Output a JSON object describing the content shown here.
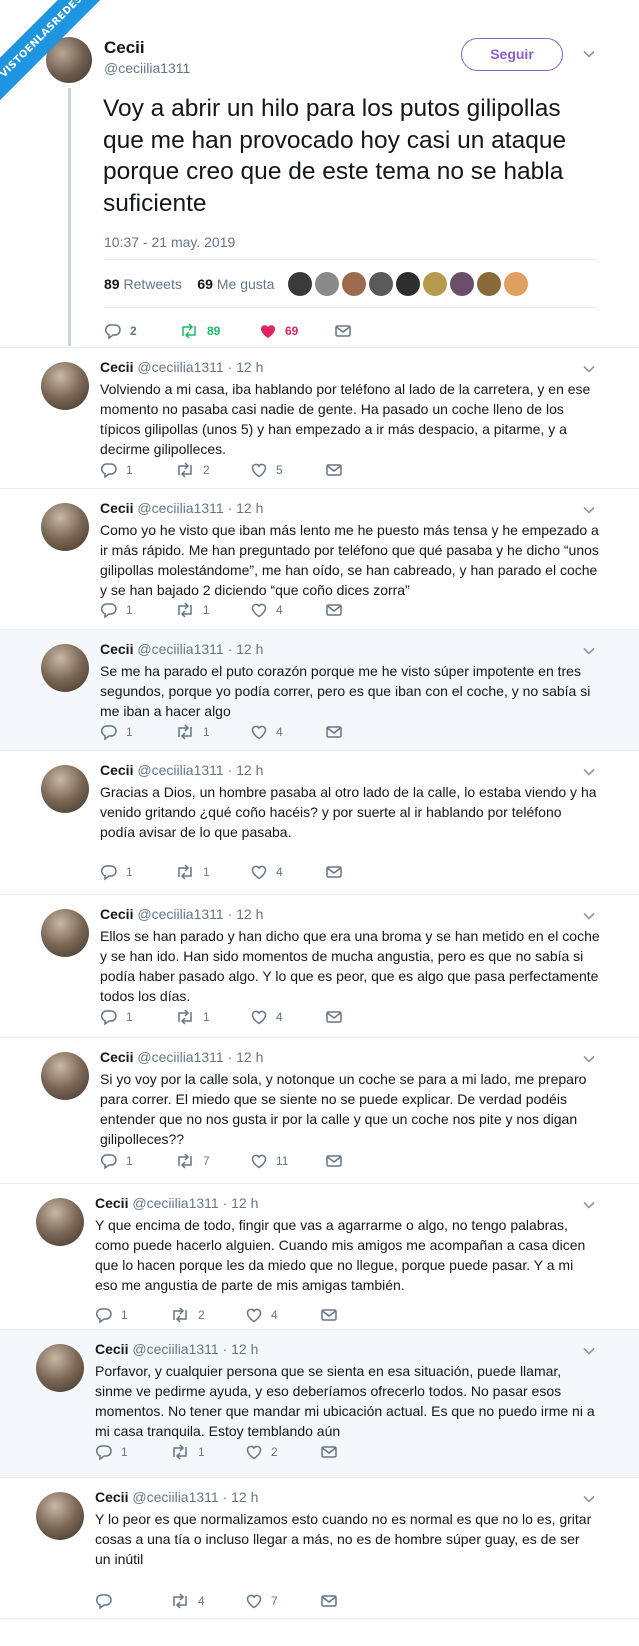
{
  "watermark": "VISTOENLASREDES",
  "colors": {
    "follow": "#8b5fd1",
    "retweet": "#17bf63",
    "like": "#e0245e",
    "muted": "#657786"
  },
  "main": {
    "name": "Cecii",
    "handle": "@ceciilia1311",
    "follow_label": "Seguir",
    "text": "Voy a abrir un hilo para los putos gilipollas que me han provocado hoy casi un ataque porque creo que de este tema no se habla suficiente",
    "time": "10:37 - 21 may. 2019",
    "retweets_count": "89",
    "retweets_label": "Retweets",
    "likes_count": "69",
    "likes_label": "Me gusta",
    "reply_count": "2",
    "retweet_count": "89",
    "like_count": "69"
  },
  "replies": [
    {
      "name": "Cecii",
      "handle": "@ceciilia1311 · 12 h",
      "text": "Volviendo a mi casa, iba hablando por teléfono al lado de la carretera, y en ese momento no pasaba casi nadie de gente. Ha pasado un coche lleno de los típicos gilipollas (unos 5) y han empezado a ir más despacio, a pitarme, y a decirme gilipolleces.",
      "replies": "1",
      "retweets": "2",
      "likes": "5"
    },
    {
      "name": "Cecii",
      "handle": "@ceciilia1311 · 12 h",
      "text": "Como yo he visto que iban más lento me he puesto más tensa y he empezado a ir más rápido. Me han preguntado por teléfono que qué pasaba y he dicho “unos gilipollas molestándome”, me han oído, se han cabreado, y han parado el coche y se han bajado 2 diciendo “que coño dices zorra”",
      "replies": "1",
      "retweets": "1",
      "likes": "4"
    },
    {
      "name": "Cecii",
      "handle": "@ceciilia1311 · 12 h",
      "text": "Se me ha parado el puto corazón porque me he visto súper impotente en tres segundos, porque yo podía correr, pero es que iban con el coche, y no sabía si me iban a hacer algo",
      "replies": "1",
      "retweets": "1",
      "likes": "4"
    },
    {
      "name": "Cecii",
      "handle": "@ceciilia1311 · 12 h",
      "text": "Gracias a Dios, un hombre pasaba al otro lado de la calle, lo estaba viendo y ha venido gritando ¿qué coño hacéis? y por suerte al ir hablando por teléfono podía avisar de lo que pasaba.",
      "replies": "1",
      "retweets": "1",
      "likes": "4"
    },
    {
      "name": "Cecii",
      "handle": "@ceciilia1311 · 12 h",
      "text": "Ellos se han parado y han dicho que era una broma y se han metido en el coche y se han ido. Han sido momentos de mucha angustia, pero es que no sabía si podía haber pasado algo. Y lo que es peor, que es algo que pasa perfectamente todos los días.",
      "replies": "1",
      "retweets": "1",
      "likes": "4"
    },
    {
      "name": "Cecii",
      "handle": "@ceciilia1311 · 12 h",
      "text": "Si yo voy por la calle sola, y notonque un coche se para a mi lado, me preparo para correr. El miedo que se siente no se puede explicar. De verdad podéis entender que no nos gusta ir por la calle y que un coche nos pite y nos digan gilipolleces??",
      "replies": "1",
      "retweets": "7",
      "likes": "11"
    },
    {
      "name": "Cecii",
      "handle": "@ceciilia1311 · 12 h",
      "text": "Y que encima de todo, fingir que vas a agarrarme o algo, no tengo palabras, como puede hacerlo alguien. Cuando mis amigos me acompañan a casa dicen que lo hacen porque les da miedo que no llegue, porque puede pasar. Y a mi eso me angustia de parte de mis amigas también.",
      "replies": "1",
      "retweets": "2",
      "likes": "4"
    },
    {
      "name": "Cecii",
      "handle": "@ceciilia1311 · 12 h",
      "text": "Porfavor, y cualquier persona que se sienta en esa situación, puede llamar, sinme ve pedirme ayuda, y eso deberíamos ofrecerlo todos. No pasar esos momentos. No tener que mandar mi ubicación actual. Es que no puedo irme ni a mi casa tranquila. Estoy temblando aún",
      "replies": "1",
      "retweets": "1",
      "likes": "2"
    },
    {
      "name": "Cecii",
      "handle": "@ceciilia1311 · 12 h",
      "text": "Y lo peor es que normalizamos esto cuando no es normal es que no lo es, gritar cosas a una tía o incluso llegar a más, no es de hombre súper guay, es de ser un inútil",
      "replies": "",
      "retweets": "4",
      "likes": "7"
    }
  ]
}
